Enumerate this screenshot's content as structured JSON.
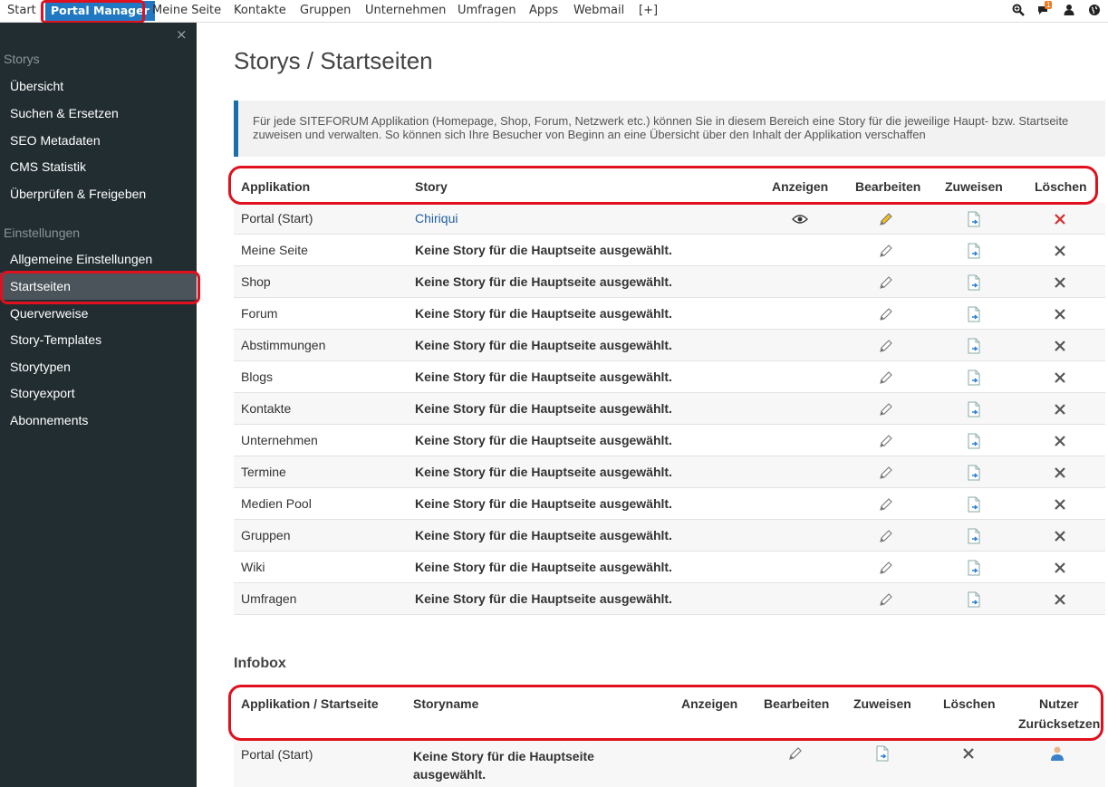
{
  "topnav": {
    "items": [
      "Start",
      "Portal Manager",
      "Meine Seite",
      "Kontakte",
      "Gruppen",
      "Unternehmen",
      "Umfragen",
      "Apps",
      "Webmail",
      "[+]"
    ],
    "notification_count": "1",
    "icons": [
      "search-zoom-icon",
      "chat-icon",
      "user-icon",
      "globe-icon"
    ]
  },
  "sidebar": {
    "close": "×",
    "sections": [
      {
        "title": "Storys",
        "items": [
          "Übersicht",
          "Suchen & Ersetzen",
          "SEO Metadaten",
          "CMS Statistik",
          "Überprüfen & Freigeben"
        ]
      },
      {
        "title": "Einstellungen",
        "items": [
          "Allgemeine Einstellungen",
          "Startseiten",
          "Querverweise",
          "Story-Templates",
          "Storytypen",
          "Storyexport",
          "Abonnements"
        ]
      }
    ],
    "active_item": "Startseiten"
  },
  "main": {
    "title": "Storys / Startseiten",
    "info": "Für jede SITEFORUM Applikation (Homepage, Shop, Forum, Netzwerk etc.) können Sie in diesem Bereich eine Story für die jeweilige Haupt- bzw. Startseite zuweisen und verwalten. So können sich Ihre Besucher von Beginn an eine Übersicht über den Inhalt der Applikation verschaffen",
    "table": {
      "headers": [
        "Applikation",
        "Story",
        "Anzeigen",
        "Bearbeiten",
        "Zuweisen",
        "Löschen"
      ],
      "rows": [
        {
          "app": "Portal (Start)",
          "story": "Chiriqui"
        },
        {
          "app": "Meine Seite",
          "story": "Keine Story für die Hauptseite ausgewählt."
        },
        {
          "app": "Shop",
          "story": "Keine Story für die Hauptseite ausgewählt."
        },
        {
          "app": "Forum",
          "story": "Keine Story für die Hauptseite ausgewählt."
        },
        {
          "app": "Abstimmungen",
          "story": "Keine Story für die Hauptseite ausgewählt."
        },
        {
          "app": "Blogs",
          "story": "Keine Story für die Hauptseite ausgewählt."
        },
        {
          "app": "Kontakte",
          "story": "Keine Story für die Hauptseite ausgewählt."
        },
        {
          "app": "Unternehmen",
          "story": "Keine Story für die Hauptseite ausgewählt."
        },
        {
          "app": "Termine",
          "story": "Keine Story für die Hauptseite ausgewählt."
        },
        {
          "app": "Medien Pool",
          "story": "Keine Story für die Hauptseite ausgewählt."
        },
        {
          "app": "Gruppen",
          "story": "Keine Story für die Hauptseite ausgewählt."
        },
        {
          "app": "Wiki",
          "story": "Keine Story für die Hauptseite ausgewählt."
        },
        {
          "app": "Umfragen",
          "story": "Keine Story für die Hauptseite ausgewählt."
        }
      ]
    },
    "infobox": {
      "title": "Infobox",
      "headers": [
        "Applikation / Startseite",
        "Storyname",
        "Anzeigen",
        "Bearbeiten",
        "Zuweisen",
        "Löschen",
        "Nutzer",
        "Zurücksetzen"
      ],
      "rows": [
        {
          "app": "Portal (Start)",
          "story": "Keine Story für die Hauptseite ausgewählt."
        }
      ]
    }
  },
  "colors": {
    "sidebar_bg": "#222d32",
    "accent": "#1f78c1",
    "highlight": "#e0101e",
    "info_border": "#1b6fa8"
  }
}
